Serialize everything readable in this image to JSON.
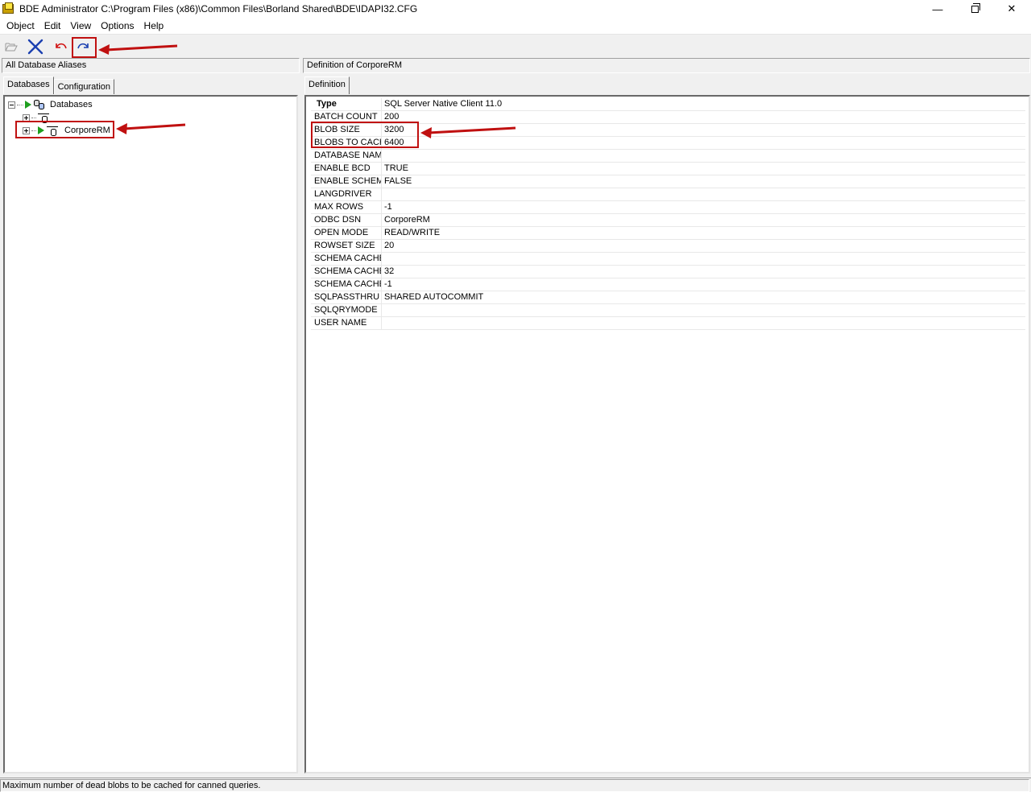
{
  "window": {
    "title": "BDE Administrator  C:\\Program Files (x86)\\Common Files\\Borland Shared\\BDE\\IDAPI32.CFG",
    "minimize": "—",
    "close": "✕"
  },
  "menu": [
    "Object",
    "Edit",
    "View",
    "Options",
    "Help"
  ],
  "toolbar": {
    "buttons": [
      "open-icon",
      "delete-icon",
      "cancel-icon",
      "apply-icon"
    ]
  },
  "left": {
    "header": "All Database Aliases",
    "tabs": [
      "Databases",
      "Configuration"
    ],
    "tree": {
      "root": "Databases",
      "selected": "CorporeRM"
    }
  },
  "right": {
    "header": "Definition of CorporeRM",
    "tab": "Definition",
    "rows": [
      {
        "name": "Type",
        "value": "SQL Server Native Client 11.0"
      },
      {
        "name": "BATCH COUNT",
        "value": "200"
      },
      {
        "name": "BLOB SIZE",
        "value": "3200"
      },
      {
        "name": "BLOBS TO CACH",
        "value": "6400"
      },
      {
        "name": "DATABASE NAM",
        "value": ""
      },
      {
        "name": "ENABLE BCD",
        "value": "TRUE"
      },
      {
        "name": "ENABLE SCHEM/",
        "value": "FALSE"
      },
      {
        "name": "LANGDRIVER",
        "value": ""
      },
      {
        "name": "MAX ROWS",
        "value": "-1"
      },
      {
        "name": "ODBC DSN",
        "value": "CorporeRM"
      },
      {
        "name": "OPEN MODE",
        "value": "READ/WRITE"
      },
      {
        "name": "ROWSET SIZE",
        "value": "20"
      },
      {
        "name": "SCHEMA CACHE",
        "value": ""
      },
      {
        "name": "SCHEMA CACHE",
        "value": "32"
      },
      {
        "name": "SCHEMA CACHE",
        "value": "-1"
      },
      {
        "name": "SQLPASSTHRU I",
        "value": "SHARED AUTOCOMMIT"
      },
      {
        "name": "SQLQRYMODE",
        "value": ""
      },
      {
        "name": "USER NAME",
        "value": ""
      }
    ]
  },
  "status": "Maximum number of dead blobs to be cached for canned queries.",
  "colors": {
    "annotation": "#c01010",
    "delete_icon": "#1a3fb0",
    "cancel_icon": "#d01010",
    "apply_icon": "#1a3fb0",
    "play_icon": "#1e9e1e"
  }
}
